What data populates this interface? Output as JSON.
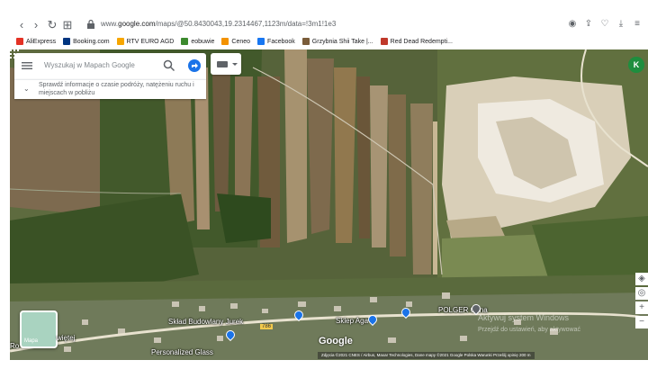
{
  "browser": {
    "url_prefix": "www.",
    "url_domain": "google.com",
    "url_rest": "/maps/@50.8430043,19.2314467,1123m/data=!3m1!1e3",
    "nav": {
      "back": "back-icon",
      "forward": "forward-icon",
      "reload": "reload-icon",
      "tabs": "tab-grid-icon"
    },
    "right_icons": [
      "camera-icon",
      "share-icon",
      "heart-icon",
      "download-icon",
      "menu-icon"
    ]
  },
  "bookmarks": [
    {
      "label": "AliExpress",
      "color": "#e43225"
    },
    {
      "label": "Booking.com",
      "color": "#003580"
    },
    {
      "label": "RTV EURO AGD",
      "color": "#f7a600"
    },
    {
      "label": "eobuwie",
      "color": "#3c8a2e"
    },
    {
      "label": "Ceneo",
      "color": "#f39200"
    },
    {
      "label": "Facebook",
      "color": "#1877f2"
    },
    {
      "label": "Grzybnia Shii Take |...",
      "color": "#7a5c3a"
    },
    {
      "label": "Red Dead Redempti...",
      "color": "#c0392b"
    }
  ],
  "search": {
    "placeholder": "Wyszukaj w Mapach Google",
    "traffic_text": "Sprawdź informacje o czasie podróży, natężeniu ruchu i miejscach w pobliżu"
  },
  "account": {
    "initial": "K",
    "color": "#1e8e3e"
  },
  "layers": {
    "label": "Mapa"
  },
  "map_labels": {
    "sklad": "Skład Budowlany Jurek",
    "sklep": "Sklep Aga",
    "polger": "POLGER Okna",
    "personalized": "Personalized Glass",
    "road": "786",
    "left_edge": "Ro",
    "left_edge2": "więtej"
  },
  "google_logo": "Google",
  "attribution": "Zdjęcia ©2021 CNES / Airbus, Maxar Technologies, Dane mapy ©2021 Google    Polska    Warunki    Prześlij opinię    200 m",
  "watermark": {
    "line1": "Aktywuj system Windows",
    "line2": "Przejdź do ustawień, aby aktywować"
  },
  "controls": [
    "compass-icon",
    "locate-icon",
    "zoom-in",
    "zoom-out"
  ],
  "zoom_in": "+",
  "zoom_out": "−"
}
